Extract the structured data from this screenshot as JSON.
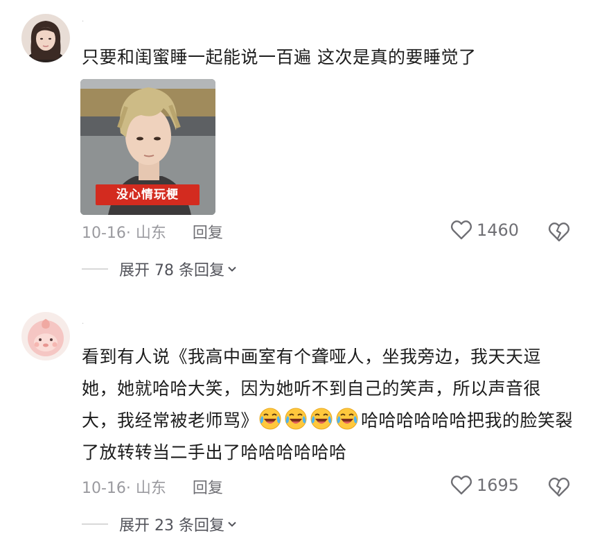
{
  "comments": [
    {
      "text": "只要和闺蜜睡一起能说一百遍 这次是真的要睡觉了",
      "meme_caption": "没心情玩梗",
      "date_location": "10-16· 山东",
      "reply_label": "回复",
      "likes": "1460",
      "expand_label": "展开 78 条回复"
    },
    {
      "text_before_emoji": "看到有人说《我高中画室有个聋哑人，坐我旁边，我天天逗她，她就哈哈大笑，因为她听不到自己的笑声，所以声音很大，我经常被老师骂》",
      "emoji_name": "laughing-crying-emoji",
      "emoji_count": 4,
      "text_after_emoji": "哈哈哈哈哈哈把我的脸笑裂了放转转当二手出了哈哈哈哈哈哈",
      "date_location": "10-16· 山东",
      "reply_label": "回复",
      "likes": "1695",
      "expand_label": "展开 23 条回复"
    }
  ],
  "icons": {
    "like": "heart-outline-icon",
    "dislike": "broken-heart-icon",
    "expand": "chevron-down-icon"
  },
  "colors": {
    "text": "#1c1c1c",
    "meta": "#9a9a9f",
    "caption_bg": "#d32b1f"
  }
}
